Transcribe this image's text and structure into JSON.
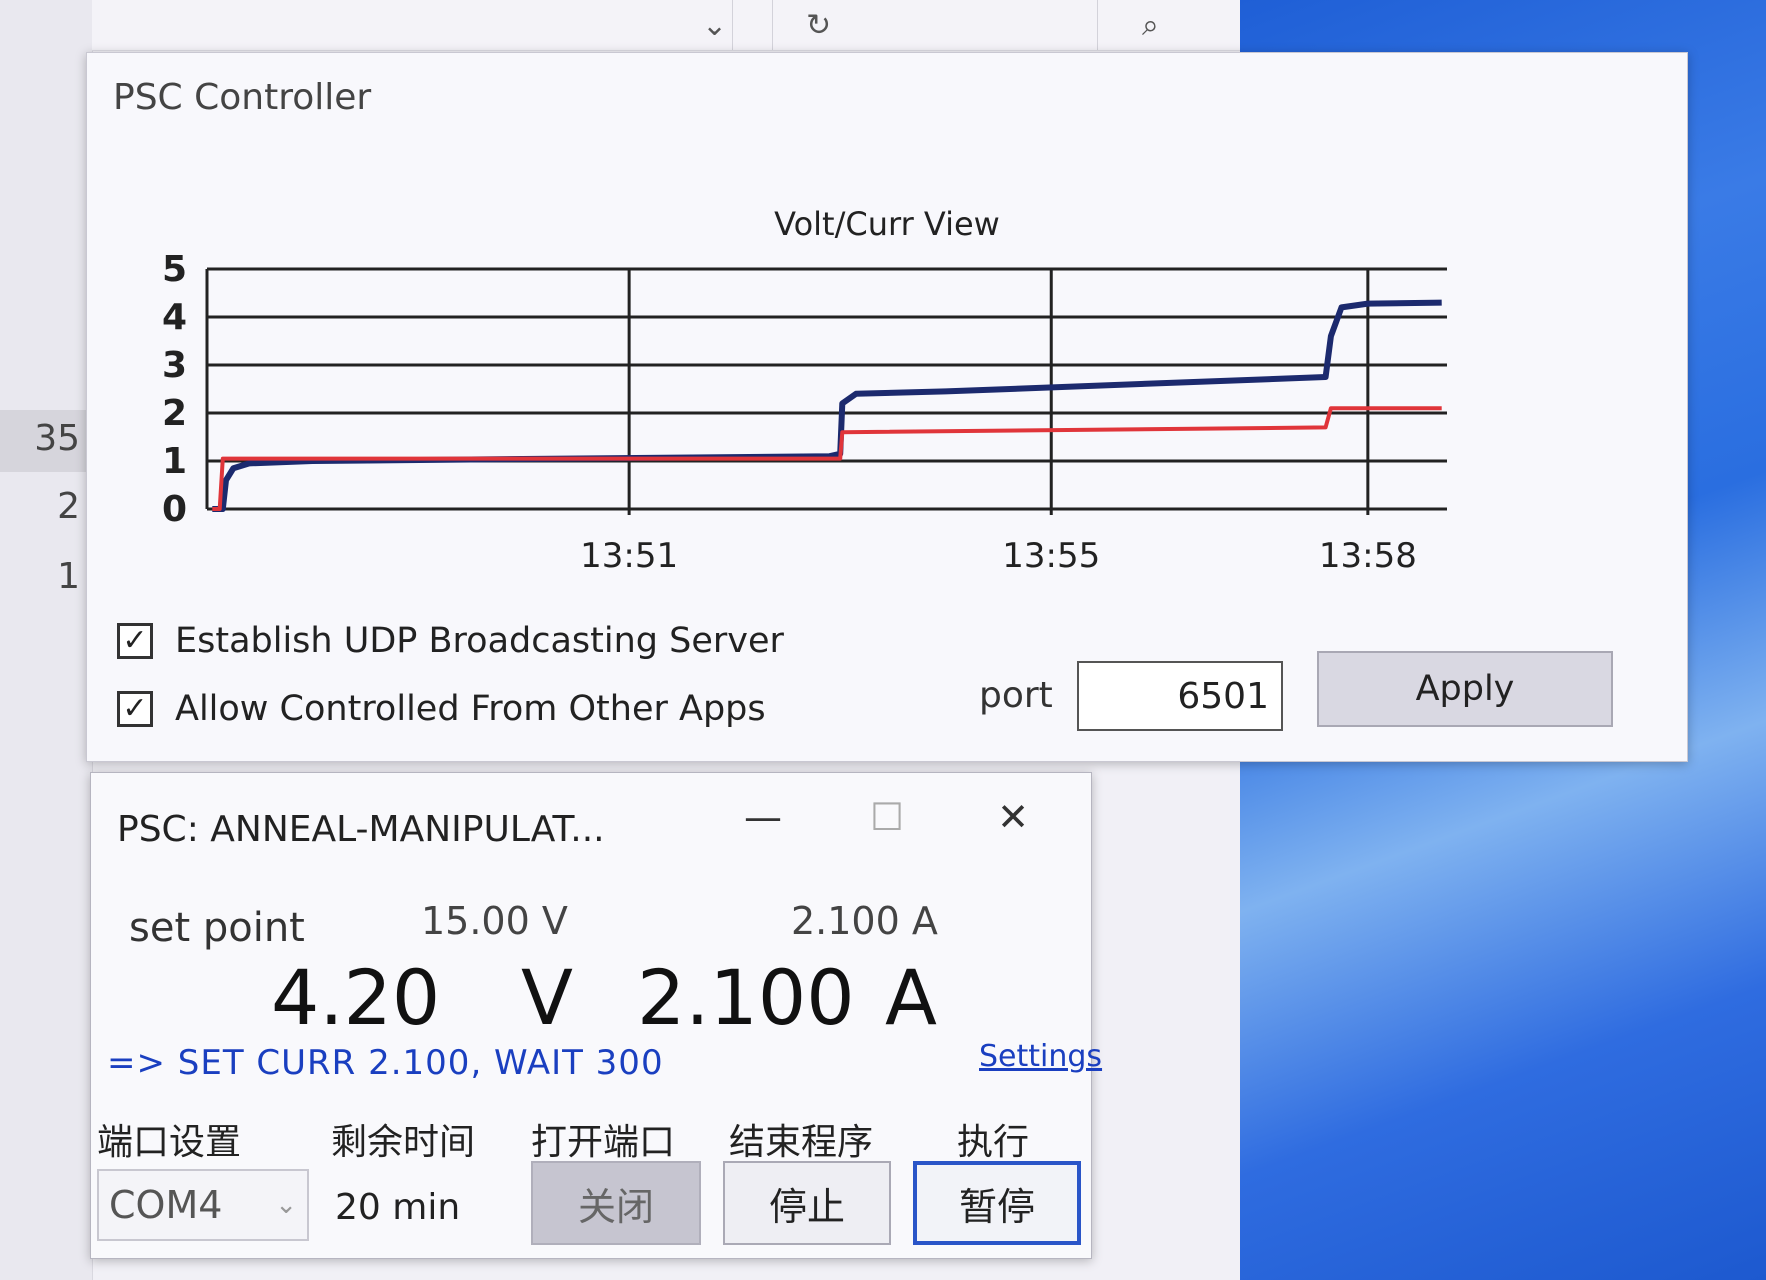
{
  "background_app": {
    "row_numbers": [
      "35",
      "2",
      "1"
    ],
    "toolbar_icons": [
      "chevron-down-icon",
      "refresh-icon",
      "search-icon"
    ]
  },
  "controller": {
    "title": "PSC Controller",
    "chart_title": "Volt/Curr View",
    "udp_label": "Establish UDP Broadcasting Server",
    "udp_checked": true,
    "allow_label": "Allow Controlled From Other Apps",
    "allow_checked": true,
    "port_label": "port",
    "port_value": "6501",
    "apply_label": "Apply"
  },
  "chart_data": {
    "type": "line",
    "title": "Volt/Curr View",
    "ylim": [
      0,
      5
    ],
    "yticks": [
      "0",
      "1",
      "2",
      "3",
      "4",
      "5"
    ],
    "xticks": [
      {
        "label": "13:51",
        "minute": 3
      },
      {
        "label": "13:55",
        "minute": 7
      },
      {
        "label": "13:58",
        "minute": 10
      }
    ],
    "xlim_minutes": [
      -1.0,
      10.75
    ],
    "grid": true,
    "series": [
      {
        "color": "#1c2a6e",
        "points": [
          [
            -0.95,
            0
          ],
          [
            -0.85,
            0
          ],
          [
            -0.82,
            0.6
          ],
          [
            -0.75,
            0.85
          ],
          [
            -0.6,
            0.95
          ],
          [
            0,
            1.0
          ],
          [
            4.9,
            1.1
          ],
          [
            5.0,
            1.15
          ],
          [
            5.02,
            2.2
          ],
          [
            5.15,
            2.4
          ],
          [
            6,
            2.45
          ],
          [
            9.6,
            2.75
          ],
          [
            9.65,
            3.6
          ],
          [
            9.75,
            4.2
          ],
          [
            10.0,
            4.28
          ],
          [
            10.7,
            4.3
          ]
        ]
      },
      {
        "color": "#e0353a",
        "points": [
          [
            -0.95,
            0
          ],
          [
            -0.88,
            0
          ],
          [
            -0.85,
            1.05
          ],
          [
            4.9,
            1.05
          ],
          [
            5.0,
            1.05
          ],
          [
            5.02,
            1.6
          ],
          [
            9.6,
            1.7
          ],
          [
            9.65,
            2.1
          ],
          [
            10.7,
            2.1
          ]
        ]
      }
    ]
  },
  "anneal_window": {
    "title": "PSC: ANNEAL-MANIPULAT...",
    "minimize_glyph": "—",
    "maximize_glyph": "☐",
    "close_glyph": "✕",
    "set_point_label": "set point",
    "set_point_voltage": "15.00 V",
    "set_point_current": "2.100 A",
    "voltage_value": "4.20",
    "voltage_unit": "V",
    "current_value": "2.100",
    "current_unit": "A",
    "command_text": "=> SET CURR 2.100, WAIT 300",
    "settings_link": "Settings",
    "col_port_settings": "端口设置",
    "col_remaining_time": "剩余时间",
    "col_open_port": "打开端口",
    "col_end_program": "结束程序",
    "col_execute": "执行",
    "port_select_value": "COM4",
    "remaining_time_value": "20 min",
    "close_button": "关闭",
    "stop_button": "停止",
    "pause_button": "暂停"
  }
}
